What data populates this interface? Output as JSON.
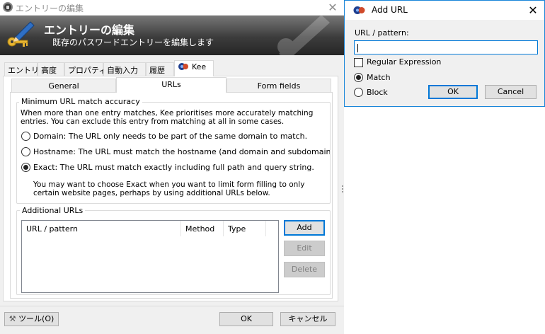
{
  "main_window": {
    "title": "エントリーの編集",
    "banner_title": "エントリーの編集",
    "banner_subtitle": "既存のパスワードエントリーを編集します",
    "tabs": [
      {
        "label": "エントリー"
      },
      {
        "label": "高度"
      },
      {
        "label": "プロパティ"
      },
      {
        "label": "自動入力"
      },
      {
        "label": "履歴"
      },
      {
        "label": "Kee",
        "selected": true
      }
    ],
    "kee_tabs": [
      {
        "label": "General"
      },
      {
        "label": "URLs",
        "selected": true
      },
      {
        "label": "Form fields"
      }
    ],
    "match_accuracy": {
      "legend": "Minimum URL match accuracy",
      "description_line1": "When more than one entry matches, Kee prioritises more accurately matching",
      "description_line2": "entries. You can exclude this entry from matching at all in some cases.",
      "options": [
        {
          "label": "Domain: The URL only needs to be part of the same domain to match.",
          "checked": false
        },
        {
          "label": "Hostname: The URL must match the hostname (and domain and subdomains) and port",
          "checked": false
        },
        {
          "label": "Exact: The URL must match exactly including full path and query string.",
          "checked": true
        }
      ],
      "note_line1": "You may want to choose Exact when you want to limit form filling to only",
      "note_line2": "certain website pages, perhaps by using additional URLs below."
    },
    "additional_urls": {
      "legend": "Additional URLs",
      "columns": [
        "URL / pattern",
        "Method",
        "Type"
      ],
      "rows": [],
      "add_label": "Add",
      "edit_label": "Edit",
      "delete_label": "Delete"
    },
    "tools_label": "ツール(O)",
    "ok_label": "OK",
    "cancel_label": "キャンセル"
  },
  "add_url_dialog": {
    "title": "Add URL",
    "url_label": "URL / pattern:",
    "url_value": "",
    "regex_label": "Regular Expression",
    "regex_checked": false,
    "match_label": "Match",
    "match_checked": true,
    "block_label": "Block",
    "block_checked": false,
    "ok_label": "OK",
    "cancel_label": "Cancel"
  },
  "colors": {
    "accent": "#0078d7",
    "banner": "#3c3c3c",
    "dialog_border": "#1a86d9"
  },
  "icons": [
    "keepass-lock-icon",
    "key-pen-icon",
    "kee-logo-icon",
    "close-icon",
    "tools-icon"
  ]
}
